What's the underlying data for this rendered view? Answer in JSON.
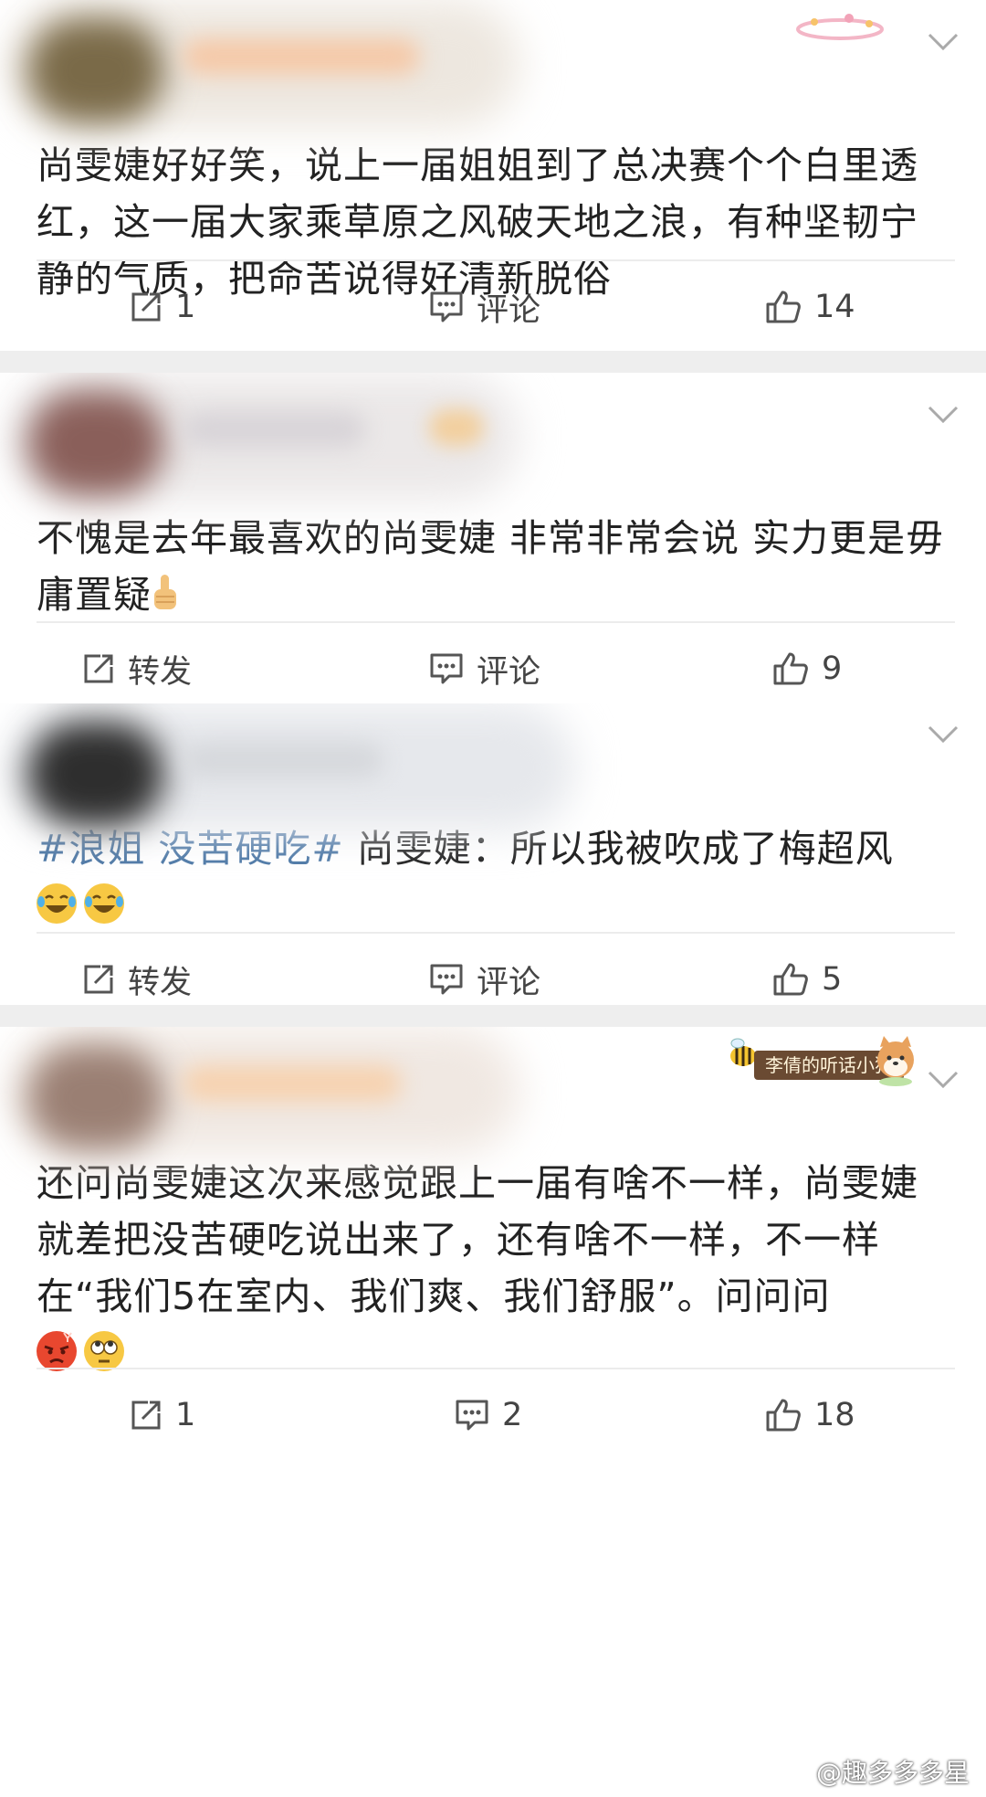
{
  "posts": [
    {
      "text": "尚雯婕好好笑，说上一届姐姐到了总决赛个个白里透红，这一届大家乘草原之风破天地之浪，有种坚韧宁静的气质，把命苦说得好清新脱俗",
      "actions": {
        "repost": "1",
        "comment": "评论",
        "like": "14"
      }
    },
    {
      "text": "不愧是去年最喜欢的尚雯婕 非常非常会说 实力更是毋庸置疑",
      "emoji": "thumbs-up",
      "actions": {
        "repost": "转发",
        "comment": "评论",
        "like": "9"
      }
    },
    {
      "hashtag": "#浪姐 没苦硬吃#",
      "text": " 尚雯婕：所以我被吹成了梅超风",
      "emoji": [
        "laughing-tears",
        "laughing-tears"
      ],
      "actions": {
        "repost": "转发",
        "comment": "评论",
        "like": "5"
      }
    },
    {
      "badge": "李倩的听话小狗",
      "text": "还问尚雯婕这次来感觉跟上一届有啥不一样，尚雯婕就差把没苦硬吃说出来了，还有啥不一样，不一样在“我们5在室内、我们爽、我们舒服”。问问问",
      "emoji": [
        "angry-face",
        "eye-roll-face"
      ],
      "actions": {
        "repost": "1",
        "comment": "2",
        "like": "18"
      }
    }
  ],
  "watermark": "@趣多多多星",
  "colors": {
    "hashtag": "#4d78a6",
    "separator": "#eeeeee",
    "text": "#222222",
    "icon": "#555555"
  }
}
